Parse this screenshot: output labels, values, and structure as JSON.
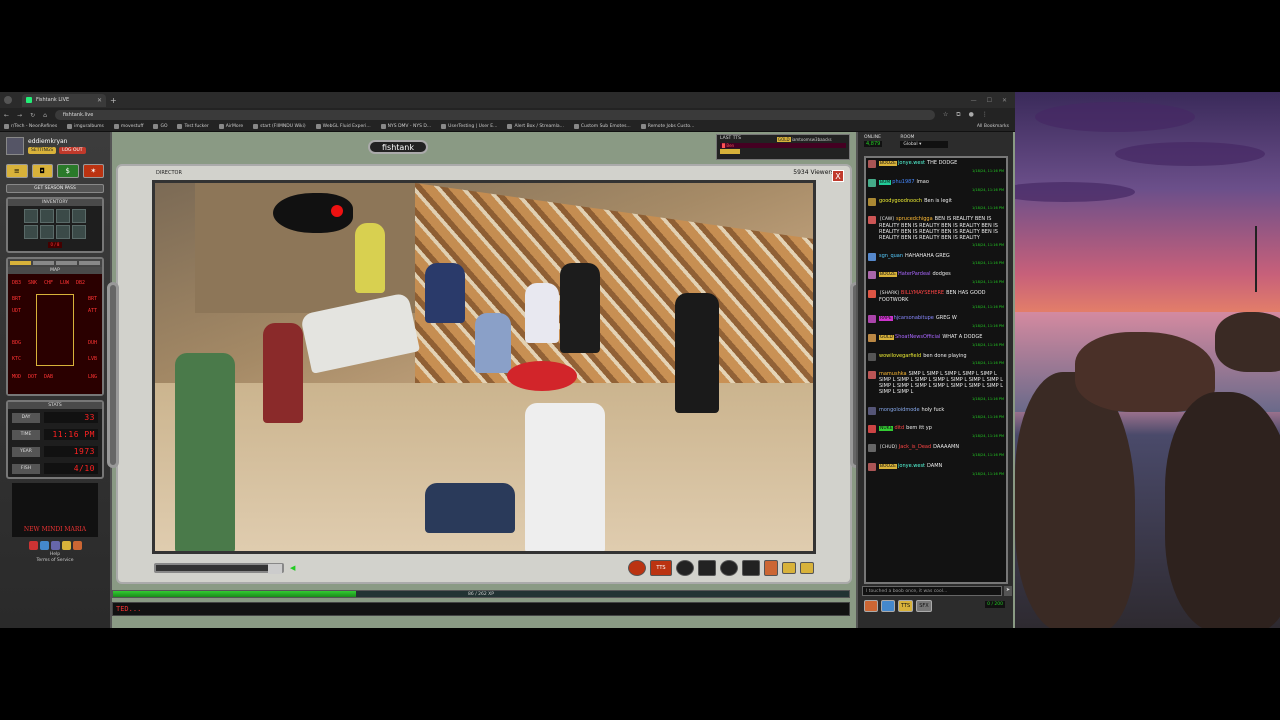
{
  "browser": {
    "tab_title": "Fishtank LIVE",
    "url": "fishtank.live",
    "bookmarks": [
      "r/Tech - NeonRefines",
      "imguralbums",
      "movestuff",
      "GO",
      "Test fucker",
      "AirMore",
      "start (FIIMNDU Wiki)",
      "WebGL Fluid Experi...",
      "NYS DMV - NYS D...",
      "UserTesting | User E...",
      "Alert Box / Streamla...",
      "Custom Sub Emotes...",
      "Remote Jobs Custo..."
    ],
    "all_bookmarks": "All Bookmarks"
  },
  "user": {
    "name": "eddiemkryan",
    "settings": "SETTINGS",
    "logout": "LOG OUT",
    "season_pass": "GET SEASON PASS"
  },
  "inventory": {
    "title": "INVENTORY",
    "count": "0 / 8"
  },
  "map": {
    "title": "MAP",
    "labels": [
      "DB3",
      "SNK",
      "CHF",
      "LUW",
      "DB2",
      "BRT",
      "BRT",
      "UDT",
      "ATT",
      "BDG",
      "DUH",
      "KTC",
      "LVB",
      "MOD",
      "DOT",
      "DAB",
      "LNG"
    ]
  },
  "stats": {
    "title": "STATS",
    "rows": [
      {
        "label": "DAY",
        "value": "33"
      },
      {
        "label": "TIME",
        "value": "11:16 PM"
      },
      {
        "label": "YEAR",
        "value": "1973"
      },
      {
        "label": "FISH",
        "value": "4/10"
      }
    ]
  },
  "footer": {
    "art_caption": "NEW MINDI MARIA",
    "help": "Help",
    "terms": "Terms of Service"
  },
  "header": {
    "logo": "fishtank",
    "last_tts": "LAST TTS",
    "tts_user": "GOLD",
    "tts_name": "iamtoomsw3baacks",
    "tts_bar": "█ Ben"
  },
  "video": {
    "camera": "DIRECTOR",
    "viewers": "5934 Viewers",
    "close": "X"
  },
  "controls": {
    "tts": "TTS"
  },
  "xp": {
    "text": "86 / 262 XP",
    "fraction": 0.33
  },
  "terminal": {
    "text": "TED..."
  },
  "chat": {
    "online_label": "ONLINE",
    "online_count": "4,879",
    "room_label": "ROOM",
    "room": "Global",
    "messages": [
      {
        "tag": "BOOZE",
        "tag_color": "#d8b23a",
        "nick": "jonye.west",
        "nick_color": "#5fd",
        "text": "THE DODGE",
        "ts": "1/18/24, 11:16 PM"
      },
      {
        "tag": "BUM",
        "tag_color": "#2c9",
        "nick": "phu1987",
        "nick_color": "#48f",
        "text": "lmao",
        "ts": "1/18/24, 11:16 PM"
      },
      {
        "tag": "",
        "tag_color": "",
        "nick": "goodygoodnooch",
        "nick_color": "#ee3",
        "text": "Ben is legit",
        "ts": "1/18/24, 11:16 PM"
      },
      {
        "tag": "[CAW]",
        "tag_color": "",
        "nick": "sprucedchigga",
        "nick_color": "#fb3",
        "text": "BEN IS REALITY BEN IS REALITY BEN IS REALITY BEN IS REALITY BEN IS REALITY BEN IS REALITY BEN IS REALITY BEN IS REALITY BEN IS REALITY BEN IS REALITY",
        "ts": "1/18/24, 11:16 PM"
      },
      {
        "tag": "",
        "tag_color": "",
        "nick": "sgn_quan",
        "nick_color": "#5cf",
        "text": "HAHAHAHA GREG",
        "ts": "1/18/24, 11:16 PM"
      },
      {
        "tag": "BOOZE",
        "tag_color": "#d8b23a",
        "nick": "HaterPardeal",
        "nick_color": "#a6f",
        "text": "dodges",
        "ts": "1/18/24, 11:16 PM"
      },
      {
        "tag": "[SHARK]",
        "tag_color": "",
        "nick": "BILLYMAYSEHERE",
        "nick_color": "#f44",
        "text": "BEN HAS GOOD FOOTWORK",
        "ts": "1/18/24, 11:16 PM"
      },
      {
        "tag": "RAPE",
        "tag_color": "#c3c",
        "nick": "hjcarsonabitupe",
        "nick_color": "#88f",
        "text": "GREG W",
        "ts": "1/18/24, 11:16 PM"
      },
      {
        "tag": "GOLD",
        "tag_color": "#d8b23a",
        "nick": "ShoatNewsOfficial",
        "nick_color": "#a6f",
        "text": "WHAT A DODGE",
        "ts": "1/18/24, 11:16 PM"
      },
      {
        "tag": "",
        "tag_color": "",
        "nick": "wowilovegarfield",
        "nick_color": "#ee3",
        "text": "ben done playing",
        "ts": "1/18/24, 11:16 PM"
      },
      {
        "tag": "",
        "tag_color": "",
        "nick": "mamushka",
        "nick_color": "#fb3",
        "text": "SIMP L SIMP L SIMP L SIMP L SIMP L SIMP L SIMP L SIMP L SIMP L SIMP L SIMP L SIMP L SIMP L SIMP L SIMP L SIMP L SIMP L SIMP L SIMP L SIMP L SIMP L",
        "ts": "1/18/24, 11:16 PM"
      },
      {
        "tag": "",
        "tag_color": "",
        "nick": "mongoloidmode",
        "nick_color": "#8ae",
        "text": "holy fuck",
        "ts": "1/18/24, 11:16 PM"
      },
      {
        "tag": "NUKE",
        "tag_color": "#3c3",
        "nick": "ditd",
        "nick_color": "#f44",
        "text": "bem itt yp",
        "ts": "1/18/24, 11:16 PM"
      },
      {
        "tag": "[CHUD]",
        "tag_color": "",
        "nick": "Jack_is_Dead",
        "nick_color": "#f44",
        "text": "DAAAAMN",
        "ts": "1/18/24, 11:16 PM"
      },
      {
        "tag": "BOOZE",
        "tag_color": "#d8b23a",
        "nick": "jonye.west",
        "nick_color": "#5fd",
        "text": "DAMN",
        "ts": "1/18/24, 11:16 PM"
      }
    ],
    "input_placeholder": "I touched a boob once, it was cool...",
    "buttons": [
      "TTS",
      "SFX"
    ],
    "char_count": "0 / 200"
  }
}
